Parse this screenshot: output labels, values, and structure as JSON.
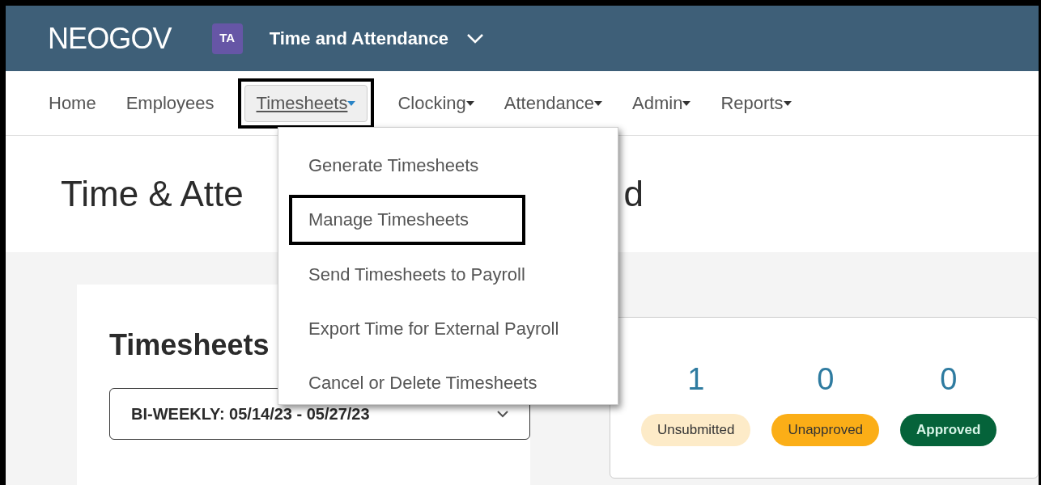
{
  "header": {
    "logo": "NEOGOV",
    "app_badge": "TA",
    "app_title": "Time and Attendance"
  },
  "nav": [
    {
      "label": "Home",
      "has_caret": false,
      "selected": false,
      "highlighted": false
    },
    {
      "label": "Employees",
      "has_caret": false,
      "selected": false,
      "highlighted": false
    },
    {
      "label": "Timesheets",
      "has_caret": true,
      "selected": true,
      "highlighted": true
    },
    {
      "label": "Clocking",
      "has_caret": true,
      "selected": false,
      "highlighted": false
    },
    {
      "label": "Attendance",
      "has_caret": true,
      "selected": false,
      "highlighted": false
    },
    {
      "label": "Admin",
      "has_caret": true,
      "selected": false,
      "highlighted": false
    },
    {
      "label": "Reports",
      "has_caret": true,
      "selected": false,
      "highlighted": false
    }
  ],
  "menu": [
    {
      "label": "Generate Timesheets",
      "highlighted": false
    },
    {
      "label": "Manage Timesheets",
      "highlighted": true
    },
    {
      "label": "Send Timesheets to Payroll",
      "highlighted": false
    },
    {
      "label": "Export Time for External Payroll",
      "highlighted": false
    },
    {
      "label": "Cancel or Delete Timesheets",
      "highlighted": false
    }
  ],
  "page_title": [
    "Time & Atte",
    "d"
  ],
  "section_title": "Timesheets",
  "period_select": {
    "value": "BI-WEEKLY: 05/14/23 - 05/27/23"
  },
  "stats": [
    {
      "count": "1",
      "label": "Unsubmitted",
      "color": "#fdebc8"
    },
    {
      "count": "0",
      "label": "Unapproved",
      "color": "#fbae17"
    },
    {
      "count": "0",
      "label": "Approved",
      "color": "#05633a"
    }
  ]
}
